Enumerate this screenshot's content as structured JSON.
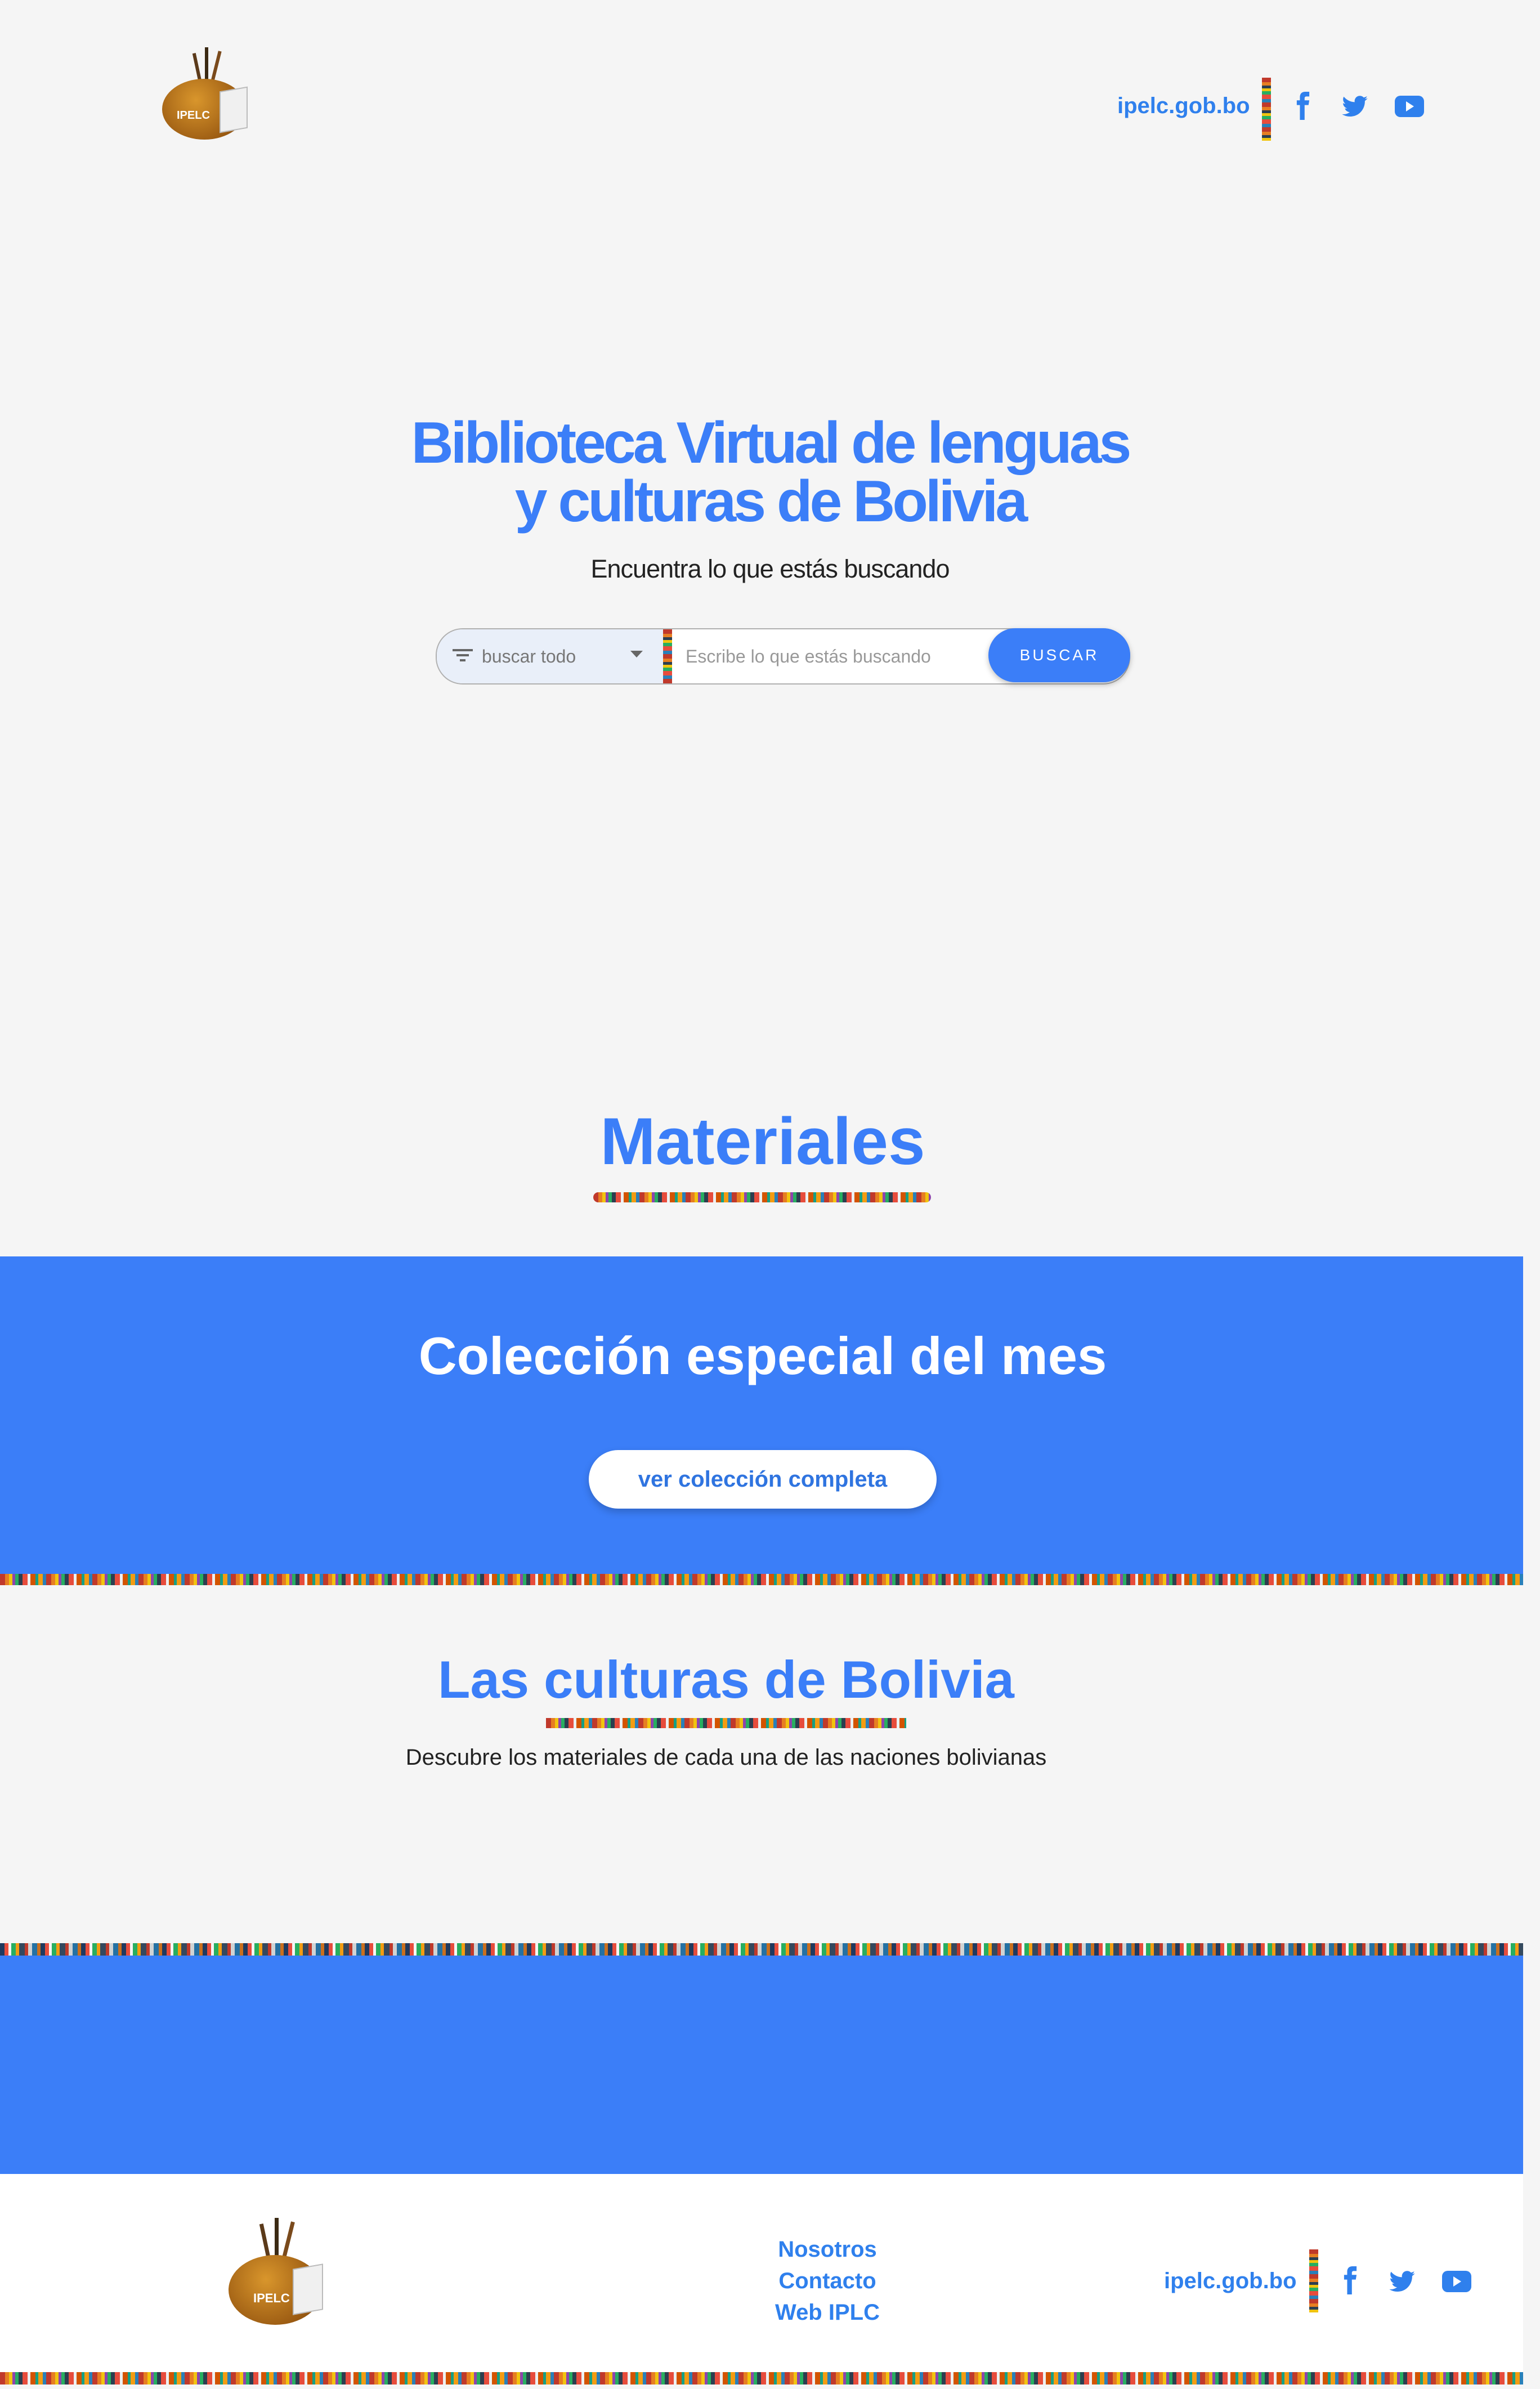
{
  "header": {
    "logo_text": "IPELC",
    "site_link": "ipelc.gob.bo",
    "social": [
      "facebook-icon",
      "twitter-icon",
      "youtube-icon"
    ]
  },
  "hero": {
    "title_line1": "Biblioteca Virtual de lenguas",
    "title_line2": "y culturas de Bolivia",
    "subtitle": "Encuentra lo que estás buscando",
    "search": {
      "filter_value": "buscar todo",
      "placeholder": "Escribe lo que estás buscando",
      "button_label": "BUSCAR"
    }
  },
  "materiales": {
    "title": "Materiales"
  },
  "coleccion": {
    "title": "Colección especial del mes",
    "button_label": "ver colección completa"
  },
  "culturas": {
    "title": "Las culturas de Bolivia",
    "description": "Descubre los materiales de cada una de las naciones bolivianas"
  },
  "footer": {
    "logo_text": "IPELC",
    "links": [
      "Nosotros",
      "Contacto",
      "Web IPLC"
    ],
    "site_link": "ipelc.gob.bo"
  },
  "colors": {
    "primary": "#3b7ef8",
    "link": "#2f80ed",
    "background": "#f5f5f5"
  }
}
